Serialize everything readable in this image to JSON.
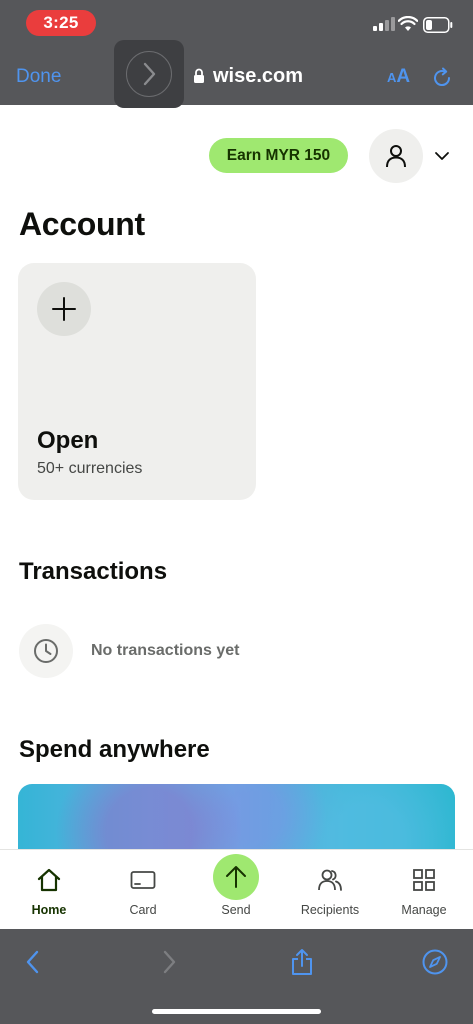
{
  "status_bar": {
    "time": "3:25"
  },
  "browser": {
    "done_label": "Done",
    "url": "wise.com",
    "text_size_small": "A",
    "text_size_big": "A"
  },
  "header": {
    "earn_label": "Earn MYR 150"
  },
  "account": {
    "title": "Account",
    "open_label": "Open",
    "open_sub": "50+ currencies"
  },
  "transactions": {
    "title": "Transactions",
    "empty_text": "No transactions yet"
  },
  "spend": {
    "title": "Spend anywhere"
  },
  "tabs": [
    {
      "label": "Home",
      "icon": "home-icon",
      "active": true
    },
    {
      "label": "Card",
      "icon": "card-icon",
      "active": false
    },
    {
      "label": "Send",
      "icon": "arrow-up-icon",
      "active": false
    },
    {
      "label": "Recipients",
      "icon": "recipients-icon",
      "active": false
    },
    {
      "label": "Manage",
      "icon": "grid-icon",
      "active": false
    }
  ],
  "colors": {
    "accent_green": "#9fe870",
    "safari_blue": "#4f94ee",
    "chrome_gray": "#56575a",
    "time_pill_red": "#ea3d3d"
  }
}
